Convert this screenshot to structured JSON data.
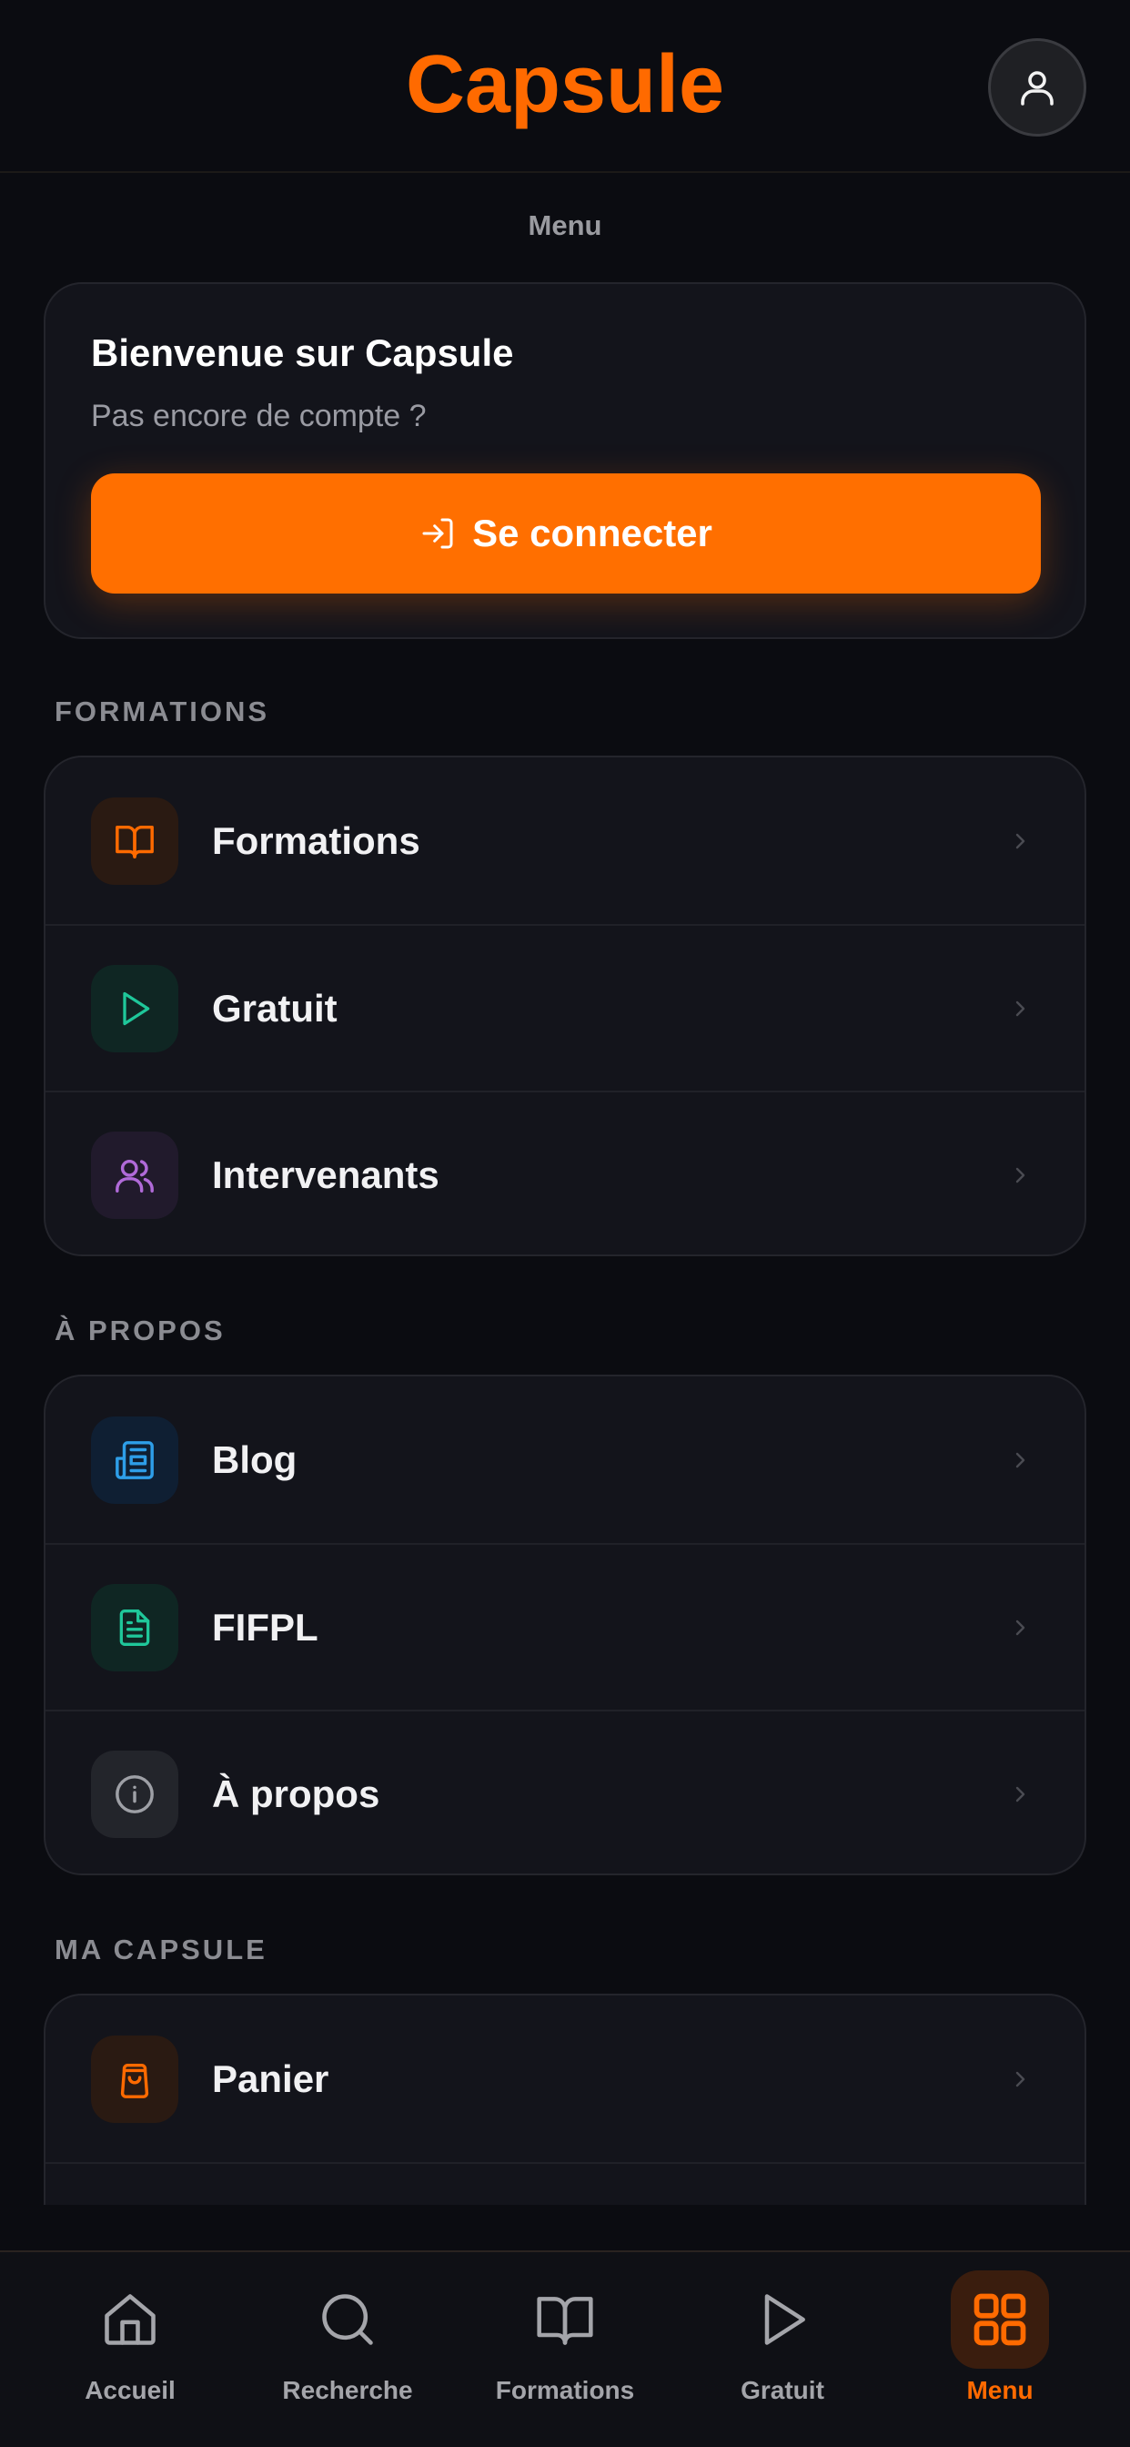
{
  "header": {
    "brand": "Capsule",
    "account_icon": "user-icon"
  },
  "page_subtitle": "Menu",
  "welcome": {
    "title": "Bienvenue sur Capsule",
    "subtitle": "Pas encore de compte ?",
    "button_label": "Se connecter",
    "button_icon": "login-icon"
  },
  "sections": [
    {
      "title": "FORMATIONS",
      "items": [
        {
          "label": "Formations",
          "icon": "book-open-icon",
          "color": "#ff6a00"
        },
        {
          "label": "Gratuit",
          "icon": "play-icon",
          "color": "#1fc79a"
        },
        {
          "label": "Intervenants",
          "icon": "users-icon",
          "color": "#b06ad8"
        }
      ]
    },
    {
      "title": "À PROPOS",
      "items": [
        {
          "label": "Blog",
          "icon": "newspaper-icon",
          "color": "#2e9ee8"
        },
        {
          "label": "FIFPL",
          "icon": "file-text-icon",
          "color": "#1fc79a"
        },
        {
          "label": "À propos",
          "icon": "info-icon",
          "color": "#9ea0a6"
        }
      ]
    },
    {
      "title": "MA CAPSULE",
      "items": [
        {
          "label": "Panier",
          "icon": "shopping-bag-icon",
          "color": "#ff6a00"
        }
      ]
    }
  ],
  "bottom_nav": [
    {
      "label": "Accueil",
      "icon": "home-icon"
    },
    {
      "label": "Recherche",
      "icon": "search-icon"
    },
    {
      "label": "Formations",
      "icon": "book-open-icon"
    },
    {
      "label": "Gratuit",
      "icon": "play-icon"
    },
    {
      "label": "Menu",
      "icon": "grid-icon",
      "active": true
    }
  ],
  "colors": {
    "accent": "#ff6a00",
    "background": "#0b0c11",
    "card": "#13141b"
  }
}
